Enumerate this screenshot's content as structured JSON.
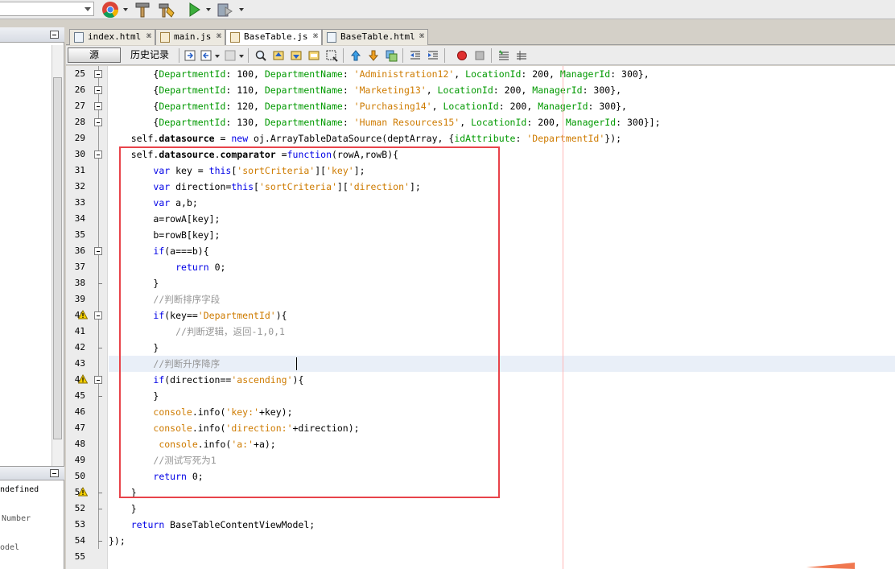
{
  "colors": {
    "keyword": "#0000e6",
    "string": "#ce7b00",
    "comment": "#969696",
    "property": "#009900",
    "highlight_box": "#e8434a",
    "current_line": "#e9eff8"
  },
  "toolbar": {
    "icons": [
      "chrome-icon",
      "hammer-icon",
      "clean-build-icon",
      "run-icon",
      "debug-icon"
    ]
  },
  "tabs": [
    {
      "label": "index.html",
      "icon": "html-file-icon",
      "active": false
    },
    {
      "label": "main.js",
      "icon": "js-file-icon",
      "active": false
    },
    {
      "label": "BaseTable.js",
      "icon": "js-file-icon",
      "active": true
    },
    {
      "label": "BaseTable.html",
      "icon": "html-file-icon",
      "active": false
    }
  ],
  "tab_close_glyph": "⌘",
  "editor_toolbar": {
    "source_label": "源",
    "history_label": "历史记录"
  },
  "navigator": {
    "items": [
      "ndefined",
      "Number",
      "odel"
    ]
  },
  "code": {
    "lines": [
      {
        "num": 25,
        "fold": "start",
        "warn": false,
        "text": "        {DepartmentId: 100, DepartmentName: 'Administration12', LocationId: 200, ManagerId: 300},"
      },
      {
        "num": 26,
        "fold": "start",
        "warn": false,
        "text": "        {DepartmentId: 110, DepartmentName: 'Marketing13', LocationId: 200, ManagerId: 300},"
      },
      {
        "num": 27,
        "fold": "start",
        "warn": false,
        "text": "        {DepartmentId: 120, DepartmentName: 'Purchasing14', LocationId: 200, ManagerId: 300},"
      },
      {
        "num": 28,
        "fold": "start",
        "warn": false,
        "text": "        {DepartmentId: 130, DepartmentName: 'Human Resources15', LocationId: 200, ManagerId: 300}];"
      },
      {
        "num": 29,
        "fold": "",
        "warn": false,
        "text": "    self.datasource = new oj.ArrayTableDataSource(deptArray, {idAttribute: 'DepartmentId'});"
      },
      {
        "num": 30,
        "fold": "start",
        "warn": false,
        "text": "    self.datasource.comparator =function(rowA,rowB){"
      },
      {
        "num": 31,
        "fold": "",
        "warn": false,
        "text": "        var key = this['sortCriteria']['key'];"
      },
      {
        "num": 32,
        "fold": "",
        "warn": false,
        "text": "        var direction=this['sortCriteria']['direction'];"
      },
      {
        "num": 33,
        "fold": "",
        "warn": false,
        "text": "        var a,b;"
      },
      {
        "num": 34,
        "fold": "",
        "warn": false,
        "text": "        a=rowA[key];"
      },
      {
        "num": 35,
        "fold": "",
        "warn": false,
        "text": "        b=rowB[key];"
      },
      {
        "num": 36,
        "fold": "start",
        "warn": false,
        "text": "        if(a===b){"
      },
      {
        "num": 37,
        "fold": "",
        "warn": false,
        "text": "            return 0;"
      },
      {
        "num": 38,
        "fold": "end",
        "warn": false,
        "text": "        }"
      },
      {
        "num": 39,
        "fold": "",
        "warn": false,
        "text": "        //判断排序字段"
      },
      {
        "num": 40,
        "fold": "start",
        "warn": true,
        "text": "        if(key=='DepartmentId'){"
      },
      {
        "num": 41,
        "fold": "",
        "warn": false,
        "text": "            //判断逻辑，返回-1,0,1"
      },
      {
        "num": 42,
        "fold": "end",
        "warn": false,
        "text": "        }"
      },
      {
        "num": 43,
        "fold": "",
        "warn": false,
        "text": "        //判断升序降序"
      },
      {
        "num": 44,
        "fold": "start",
        "warn": true,
        "text": "        if(direction=='ascending'){"
      },
      {
        "num": 45,
        "fold": "end",
        "warn": false,
        "text": "        }"
      },
      {
        "num": 46,
        "fold": "",
        "warn": false,
        "text": "        console.info('key:'+key);"
      },
      {
        "num": 47,
        "fold": "",
        "warn": false,
        "text": "        console.info('direction:'+direction);"
      },
      {
        "num": 48,
        "fold": "",
        "warn": false,
        "text": "         console.info('a:'+a);"
      },
      {
        "num": 49,
        "fold": "",
        "warn": false,
        "text": "        //测试写死为1"
      },
      {
        "num": 50,
        "fold": "",
        "warn": false,
        "text": "        return 0;"
      },
      {
        "num": 51,
        "fold": "end",
        "warn": true,
        "text": "    }"
      },
      {
        "num": 52,
        "fold": "end",
        "warn": false,
        "text": "    }"
      },
      {
        "num": 53,
        "fold": "",
        "warn": false,
        "text": "    return BaseTableContentViewModel;"
      },
      {
        "num": 54,
        "fold": "end",
        "warn": false,
        "text": "});"
      },
      {
        "num": 55,
        "fold": "",
        "warn": false,
        "text": ""
      }
    ],
    "current_line": 43
  }
}
